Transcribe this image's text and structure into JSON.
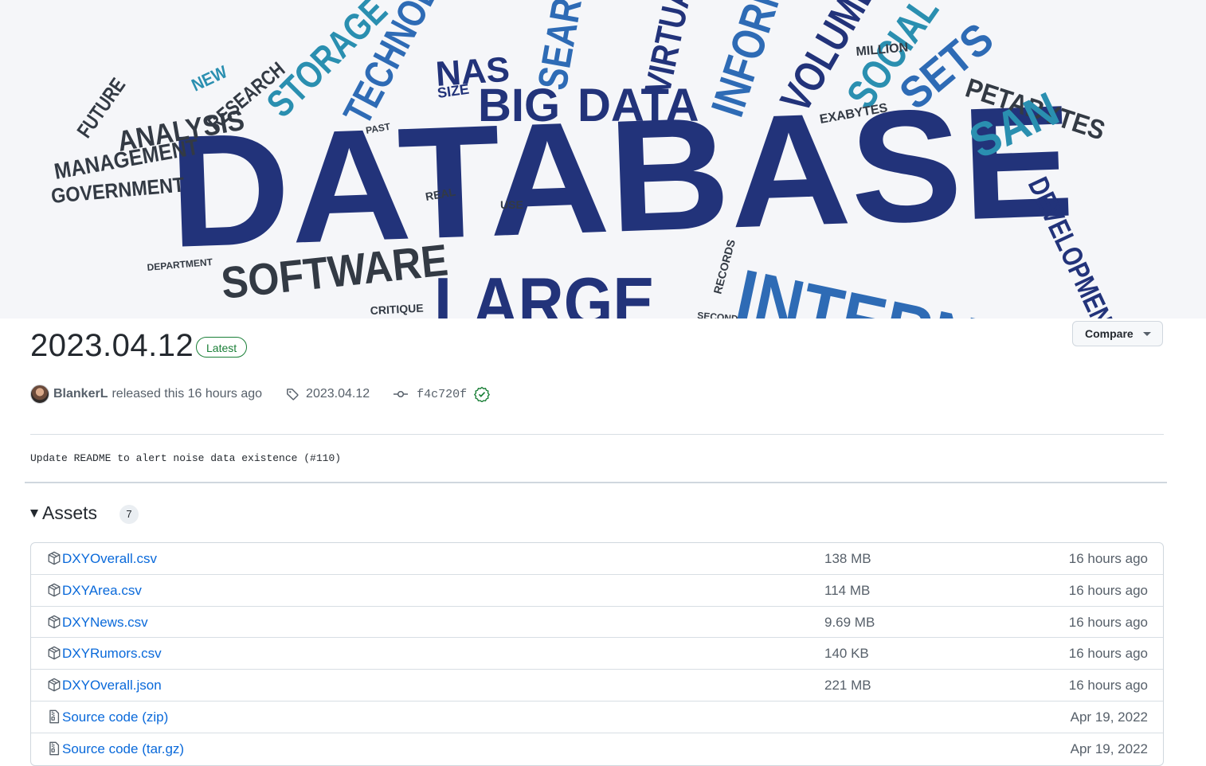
{
  "banner": {
    "alt_words": {
      "main": "DATABASE",
      "words": [
        "DATA",
        "BIG",
        "NAS",
        "SEARCH",
        "TECHNOLOGY",
        "STORAGE",
        "INFORMATION",
        "VIRTUAL",
        "VOLUME",
        "SOCIAL",
        "SETS",
        "PETABYTES",
        "SAN",
        "ANALYSIS",
        "MANAGEMENT",
        "GOVERNMENT",
        "FUTURE",
        "RESEARCH",
        "NEW",
        "SIZE",
        "SOFTWARE",
        "LARGE",
        "INTERNET",
        "DEVELOPMENT",
        "EXABYTES",
        "MILLION",
        "DEPARTMENT",
        "CRITIQUE",
        "RECORDS",
        "USE",
        "REAL",
        "PAST",
        "SECOND"
      ]
    }
  },
  "release": {
    "title": "2023.04.12",
    "latest_label": "Latest",
    "compare_label": "Compare",
    "author": "BlankerL",
    "released_text": "released this 16 hours ago",
    "tag": "2023.04.12",
    "commit": "f4c720f",
    "body": "Update README to alert noise data existence (#110)"
  },
  "assets": {
    "heading": "Assets",
    "count": "7",
    "items": [
      {
        "name": "DXYOverall.csv",
        "suffix": "",
        "size": "138 MB",
        "date": "16 hours ago",
        "icon": "package-icon"
      },
      {
        "name": "DXYArea.csv",
        "suffix": "",
        "size": "114 MB",
        "date": "16 hours ago",
        "icon": "package-icon"
      },
      {
        "name": "DXYNews.csv",
        "suffix": "",
        "size": "9.69 MB",
        "date": "16 hours ago",
        "icon": "package-icon"
      },
      {
        "name": "DXYRumors.csv",
        "suffix": "",
        "size": "140 KB",
        "date": "16 hours ago",
        "icon": "package-icon"
      },
      {
        "name": "DXYOverall.json",
        "suffix": "",
        "size": "221 MB",
        "date": "16 hours ago",
        "icon": "package-icon"
      },
      {
        "name": "Source code",
        "suffix": "(zip)",
        "size": "",
        "date": "Apr 19, 2022",
        "icon": "file-zip-icon"
      },
      {
        "name": "Source code",
        "suffix": "(tar.gz)",
        "size": "",
        "date": "Apr 19, 2022",
        "icon": "file-zip-icon"
      }
    ]
  },
  "colors": {
    "link": "#0969da",
    "muted": "#57606a",
    "success": "#1a7f37",
    "banner_navy": "#22337a",
    "banner_blue": "#2e6bb5",
    "banner_teal": "#2a8fb0"
  }
}
